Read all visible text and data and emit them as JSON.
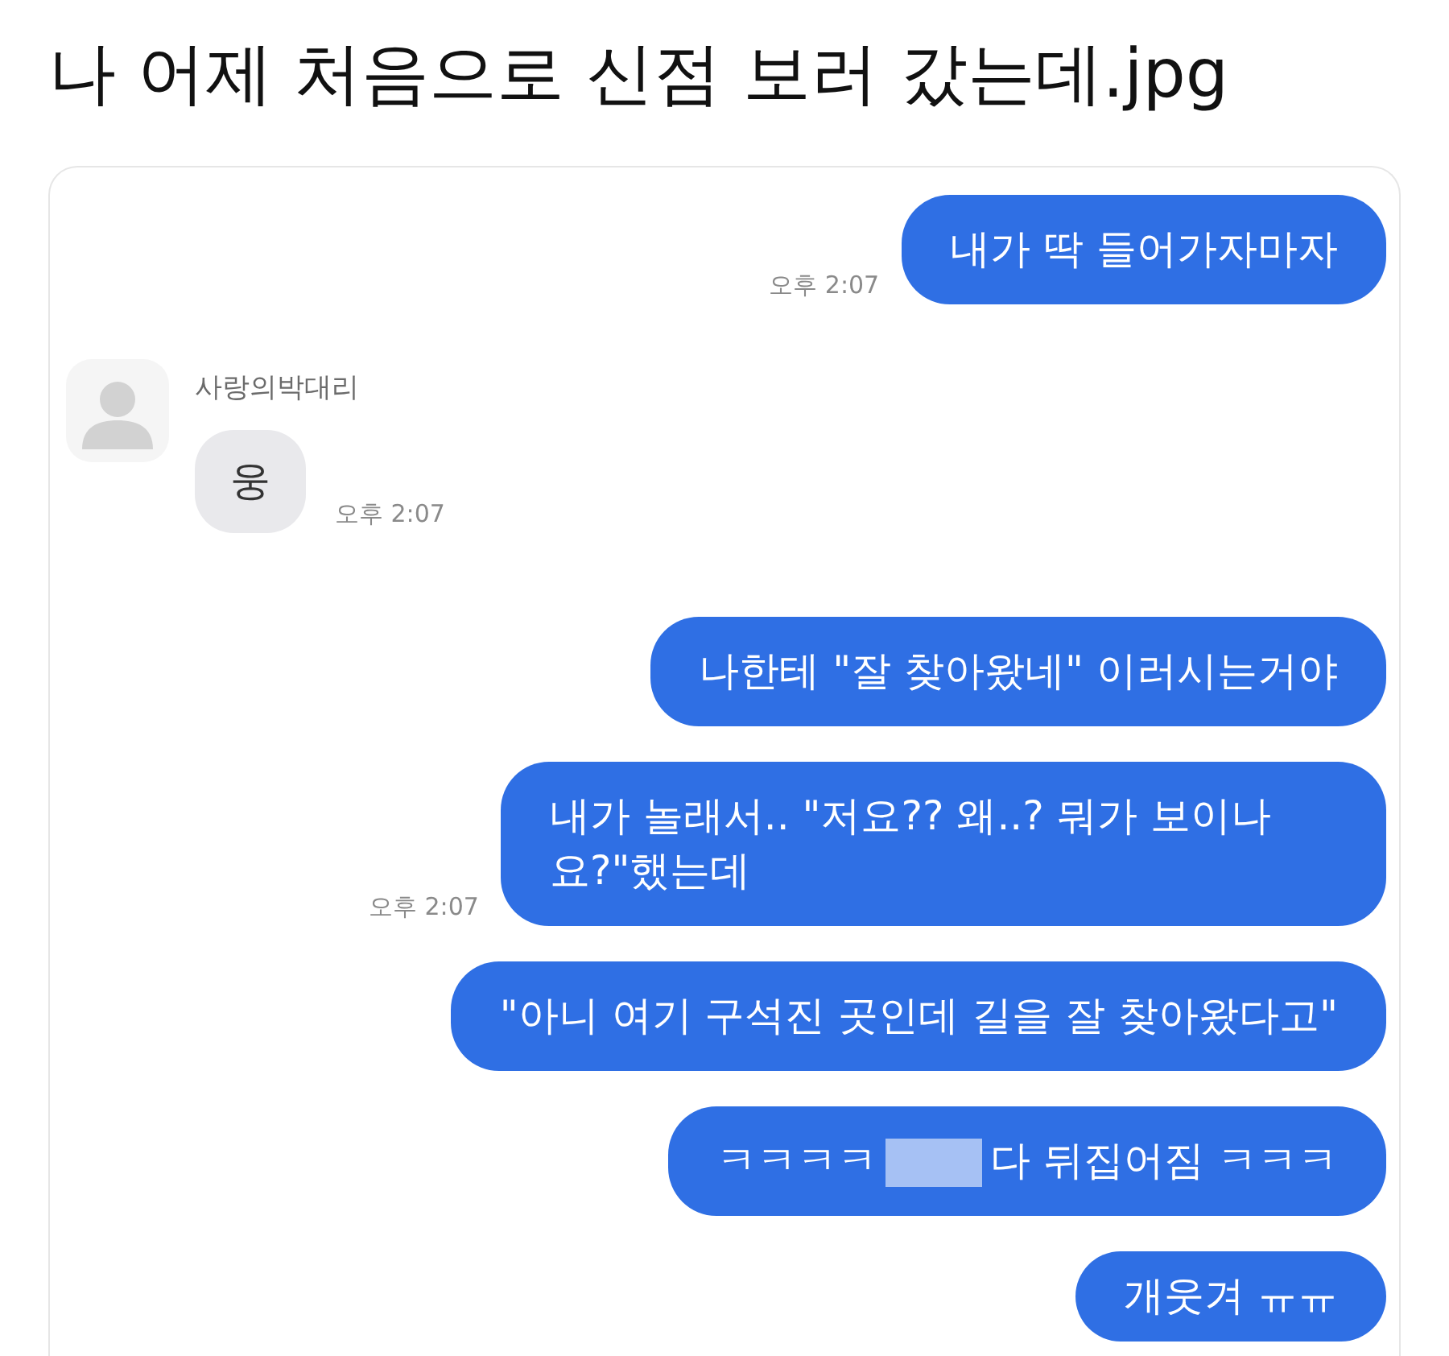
{
  "post": {
    "title": "나 어제 처음으로 신점 보러 갔는데.jpg"
  },
  "chat": {
    "messages": [
      {
        "kind": "sent",
        "text": "내가 딱 들어가자마자",
        "time": "오후 2:07"
      },
      {
        "kind": "received",
        "sender": "사랑의박대리",
        "text": "웅",
        "time": "오후 2:07"
      },
      {
        "kind": "sent",
        "text": "나한테 \"잘 찾아왔네\" 이러시는거야"
      },
      {
        "kind": "sent",
        "text": "내가 놀래서.. \"저요?? 왜..? 뭐가 보이나요?\"했는데",
        "time": "오후 2:07"
      },
      {
        "kind": "sent",
        "text": "\"아니 여기 구석진 곳인데 길을 잘 찾아왔다고\""
      },
      {
        "kind": "sent",
        "parts": [
          {
            "kind": "text",
            "text": "ㅋㅋㅋㅋ"
          },
          {
            "kind": "blur"
          },
          {
            "kind": "text",
            "text": "다 뒤집어짐 ㅋㅋㅋ"
          }
        ]
      },
      {
        "kind": "sent",
        "text": "개웃겨 ㅠㅠ"
      }
    ]
  }
}
